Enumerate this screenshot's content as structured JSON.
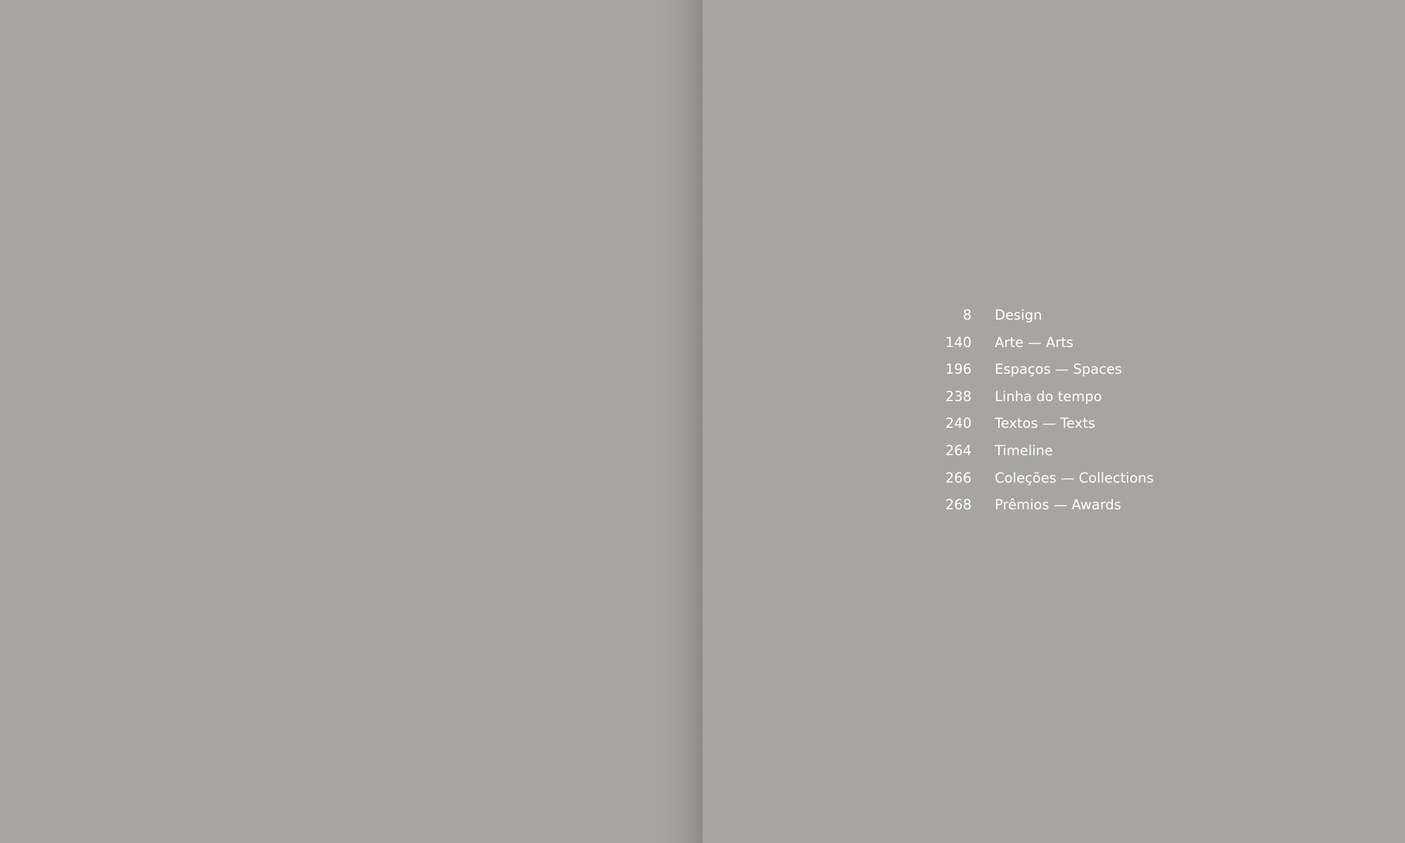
{
  "colors": {
    "page_background": "#a7a5a0",
    "text": "#ffffff"
  },
  "toc": {
    "entries": [
      {
        "page": "8",
        "title": "Design"
      },
      {
        "page": "140",
        "title": "Arte — Arts"
      },
      {
        "page": "196",
        "title": "Espaços — Spaces"
      },
      {
        "page": "238",
        "title": "Linha do tempo"
      },
      {
        "page": "240",
        "title": "Textos — Texts"
      },
      {
        "page": "264",
        "title": "Timeline"
      },
      {
        "page": "266",
        "title": "Coleções — Collections"
      },
      {
        "page": "268",
        "title": "Prêmios — Awards"
      }
    ]
  }
}
